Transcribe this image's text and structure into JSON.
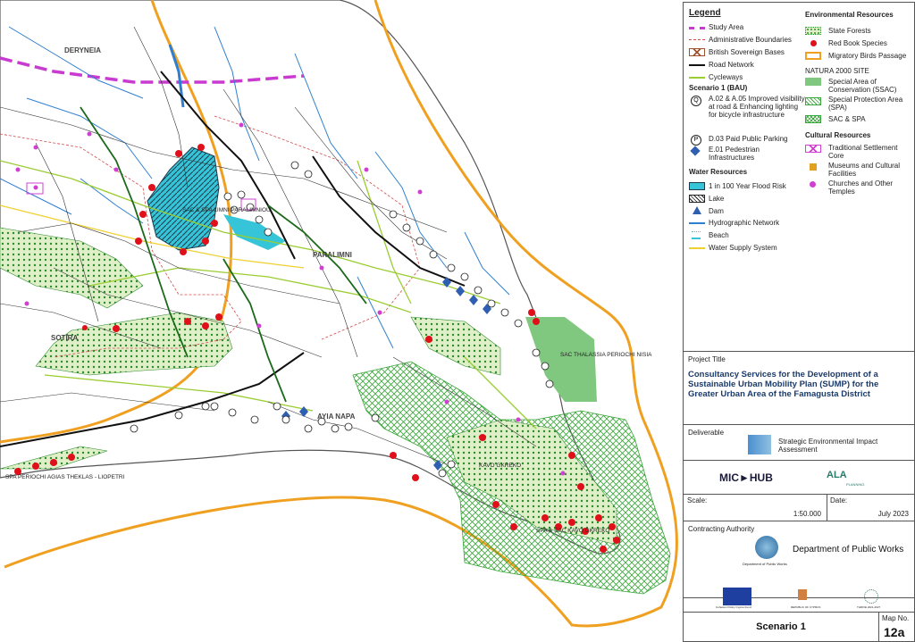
{
  "map": {
    "places": {
      "deryneia": "DERYNEIA",
      "paralimni": "PARALIMNI",
      "sotira": "SOTIRA",
      "ayia_napa": "AYIA NAPA"
    },
    "sites": {
      "limni": "SAC & SPA LIMNI PARALIMNIOU",
      "thalassia": "SAC THALASSIA PERIOCHI NISIA",
      "kavo_gkreko": "KAVO GKREKO",
      "spa_kavo": "SPA & SAC KAVO GKREKO",
      "agias_theklas": "SPA PERIOCHI AGIAS THEKLAS - LIOPETRI"
    }
  },
  "legend": {
    "title": "Legend",
    "general": [
      {
        "label": "Study Area",
        "icon": "study-area-line",
        "color": "#c93bd0"
      },
      {
        "label": "Administrative Boundaries",
        "icon": "admin-boundary-line",
        "color": "#d24b4b"
      },
      {
        "label": "British Sovereign Bases",
        "icon": "hatched-box",
        "color": "#a0522d"
      },
      {
        "label": "Road Network",
        "icon": "road-line",
        "color": "#111111"
      },
      {
        "label": "Cycleways",
        "icon": "cycleway-line",
        "color": "#9acd32"
      }
    ],
    "scenario_title": "Scenario 1 (BAU)",
    "scenario_items": [
      {
        "label": "A.02 & A.05 Improved visibility at road & Enhancing lighting for bicycle infrastructure",
        "icon": "q-circle-icon"
      },
      {
        "label": "D.03 Paid Public Parking",
        "icon": "p-circle-icon"
      },
      {
        "label": "E.01 Pedestrian Infrastructures",
        "icon": "blue-diamond-icon"
      }
    ],
    "water_title": "Water Resources",
    "water_items": [
      {
        "label": "1 in 100 Year Flood Risk",
        "icon": "flood-box",
        "color": "#36c5d8"
      },
      {
        "label": "Lake",
        "icon": "lake-hatch-box"
      },
      {
        "label": "Dam",
        "icon": "triangle-icon",
        "color": "#2f5fb0"
      },
      {
        "label": "Hydrographic Network",
        "icon": "water-line",
        "color": "#2f7fd0"
      },
      {
        "label": "Beach",
        "icon": "beach-icon",
        "color": "#36c5d8"
      },
      {
        "label": "Water Supply System",
        "icon": "supply-line",
        "color": "#f0d030"
      }
    ],
    "env_title": "Environmental Resources",
    "env_items": [
      {
        "label": "State Forests",
        "icon": "forest-box",
        "color": "#2e8b2e"
      },
      {
        "label": "Red Book Species",
        "icon": "red-dot-icon",
        "color": "#e0101a"
      },
      {
        "label": "Migratory Birds Passage",
        "icon": "orange-outline-box",
        "color": "#f0a020"
      }
    ],
    "natura_title": "NATURA 2000 SITE",
    "natura_items": [
      {
        "label": "Special Area of Conservation (SSAC)",
        "icon": "green-box",
        "color": "#80c880"
      },
      {
        "label": "Special Protection Area (SPA)",
        "icon": "green-hatch-box"
      },
      {
        "label": "SAC & SPA",
        "icon": "green-cross-hatch-box"
      }
    ],
    "cultural_title": "Cultural Resources",
    "cultural_items": [
      {
        "label": "Traditional Settlement Core",
        "icon": "magenta-cross-box",
        "color": "#d040d0"
      },
      {
        "label": "Museums and Cultural Facilities",
        "icon": "museum-icon",
        "color": "#e0a020"
      },
      {
        "label": "Churches and Other Temples",
        "icon": "church-icon",
        "color": "#d040d0"
      }
    ]
  },
  "project": {
    "label": "Project Title",
    "title": "Consultancy Services for the Development of a Sustainable Urban Mobility Plan (SUMP) for the Greater Urban Area of the Famagusta District"
  },
  "deliverable": {
    "label": "Deliverable",
    "text": "Strategic Environmental Impact Assessment"
  },
  "logos": {
    "mic": "MIC",
    "hub": "HUB",
    "ala": "ALA",
    "ala_sub": "PLANNING"
  },
  "scale": {
    "label": "Scale:",
    "value": "1:50.000"
  },
  "date": {
    "label": "Date:",
    "value": "July 2023"
  },
  "authority": {
    "label": "Contracting Authority",
    "name": "Department of Public Works",
    "emblem_caption": "Department of Public Works"
  },
  "footer_logos": {
    "eu": "Cohesion Policy Cyprus Fund",
    "cyprus": "REPUBLIC OF CYPRUS",
    "third": "THRIVE 2021-2027"
  },
  "map_info": {
    "scenario": "Scenario 1",
    "number_label": "Map No.",
    "number": "12a"
  }
}
